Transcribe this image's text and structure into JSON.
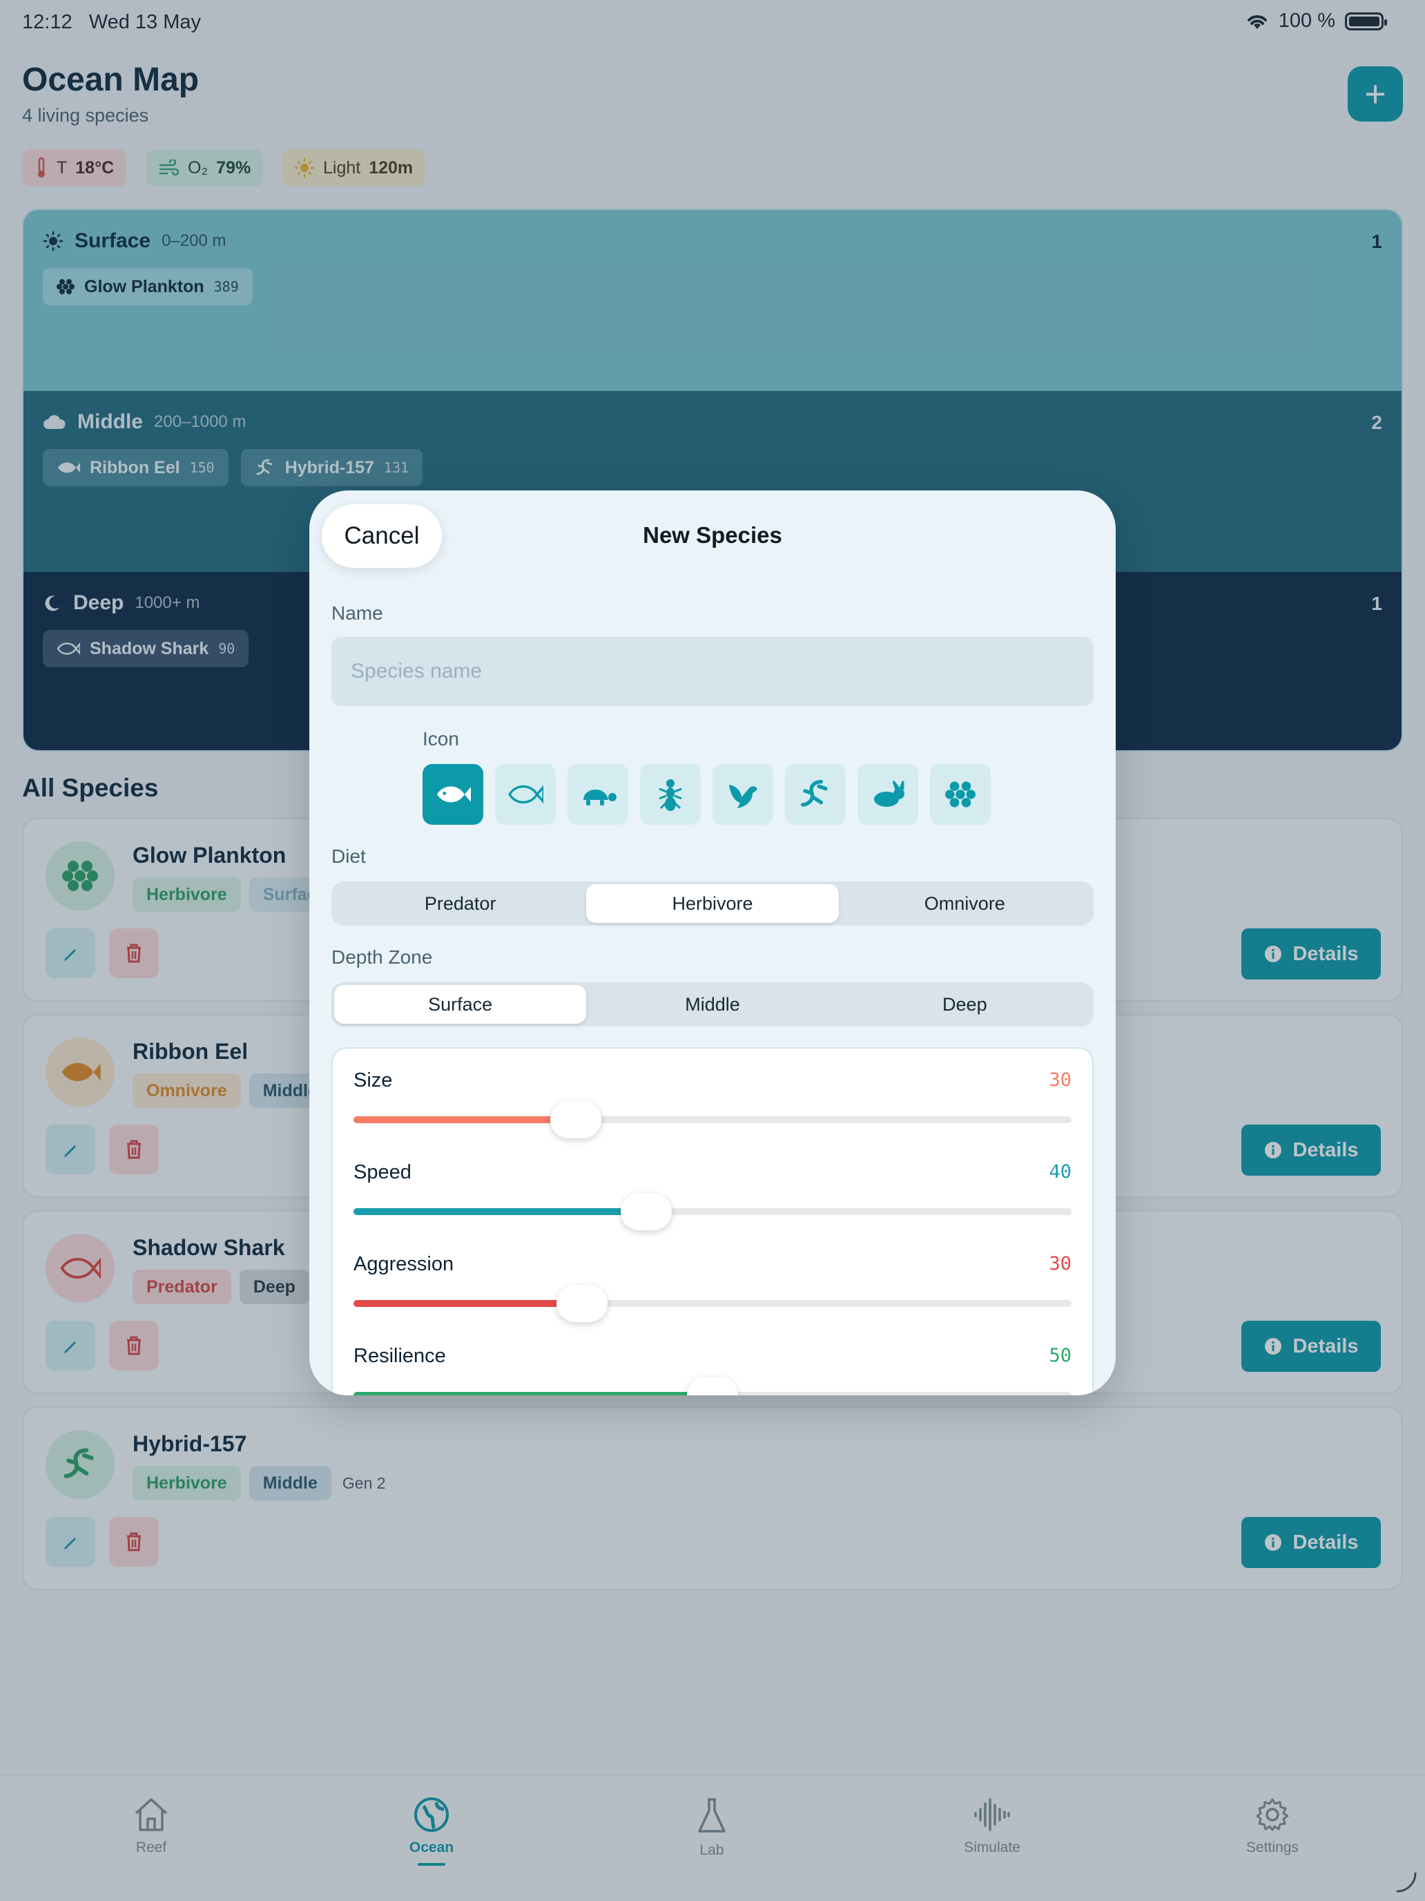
{
  "status": {
    "time": "12:12",
    "date": "Wed 13 May",
    "battery": "100 %"
  },
  "header": {
    "title": "Ocean Map",
    "subtitle": "4 living species"
  },
  "env": {
    "temp_label": "T",
    "temp_value": "18°C",
    "o2_label": "O₂",
    "o2_value": "79%",
    "light_label": "Light",
    "light_value": "120m"
  },
  "zones": [
    {
      "name": "Surface",
      "range": "0–200 m",
      "count": "1",
      "tags": [
        {
          "name": "Glow Plankton",
          "num": "389"
        }
      ]
    },
    {
      "name": "Middle",
      "range": "200–1000 m",
      "count": "2",
      "tags": [
        {
          "name": "Ribbon Eel",
          "num": "150"
        },
        {
          "name": "Hybrid-157",
          "num": "131"
        }
      ]
    },
    {
      "name": "Deep",
      "range": "1000+ m",
      "count": "1",
      "tags": [
        {
          "name": "Shadow Shark",
          "num": "90"
        }
      ]
    }
  ],
  "all_species_title": "All Species",
  "species": [
    {
      "name": "Glow Plankton",
      "diet": "Herbivore",
      "zone": "Surface",
      "gen": ""
    },
    {
      "name": "Ribbon Eel",
      "diet": "Omnivore",
      "zone": "Middle",
      "gen": ""
    },
    {
      "name": "Shadow Shark",
      "diet": "Predator",
      "zone": "Deep",
      "gen": ""
    },
    {
      "name": "Hybrid-157",
      "diet": "Herbivore",
      "zone": "Middle",
      "gen": "Gen 2"
    }
  ],
  "details_label": "Details",
  "tabs": [
    {
      "label": "Reef",
      "icon": "house-icon"
    },
    {
      "label": "Ocean",
      "icon": "globe-icon"
    },
    {
      "label": "Lab",
      "icon": "flask-icon"
    },
    {
      "label": "Simulate",
      "icon": "waveform-icon"
    },
    {
      "label": "Settings",
      "icon": "gear-icon"
    }
  ],
  "modal": {
    "cancel": "Cancel",
    "title": "New Species",
    "name_label": "Name",
    "name_placeholder": "Species name",
    "name_value": "",
    "icon_label": "Icon",
    "icons": [
      "fish-filled-icon",
      "fish-outline-icon",
      "turtle-icon",
      "ant-icon",
      "bird-icon",
      "lizard-icon",
      "rabbit-icon",
      "cluster-icon"
    ],
    "diet_label": "Diet",
    "diet_options": [
      "Predator",
      "Herbivore",
      "Omnivore"
    ],
    "diet_selected": "Herbivore",
    "zone_label": "Depth Zone",
    "zone_options": [
      "Surface",
      "Middle",
      "Deep"
    ],
    "zone_selected": "Surface",
    "sliders": [
      {
        "label": "Size",
        "value": "30",
        "fraction": 0.31,
        "color": "#f47c63"
      },
      {
        "label": "Speed",
        "value": "40",
        "fraction": 0.408,
        "color": "#1a9eaf"
      },
      {
        "label": "Aggression",
        "value": "30",
        "fraction": 0.318,
        "color": "#e34a4a"
      },
      {
        "label": "Resilience",
        "value": "50",
        "fraction": 0.5,
        "color": "#2eaa6a"
      }
    ]
  }
}
